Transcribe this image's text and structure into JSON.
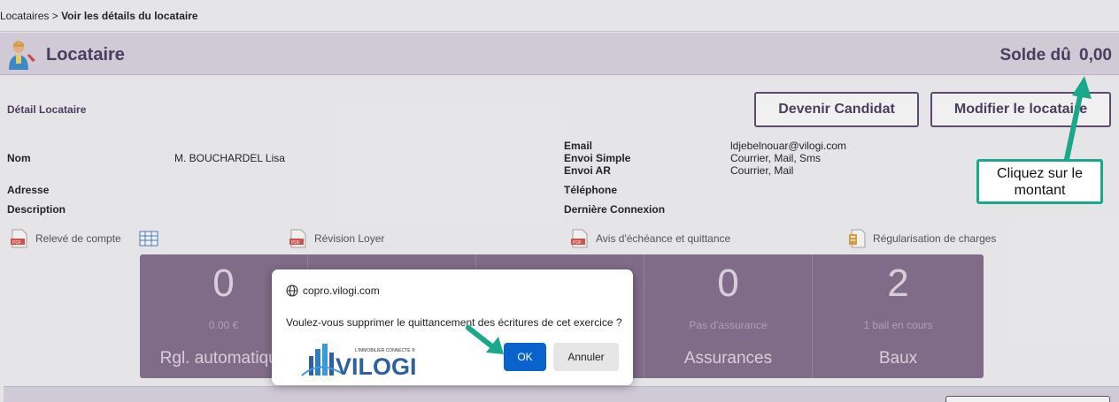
{
  "breadcrumb": {
    "parent": "Locataires",
    "separator": " > ",
    "current": "Voir les détails du locataire"
  },
  "header": {
    "title": "Locataire",
    "balance_label": "Solde dû",
    "balance_value": "0,00"
  },
  "detail": {
    "section_title": "Détail Locataire",
    "btn_candidat": "Devenir Candidat",
    "btn_modifier": "Modifier le locataire",
    "nom_label": "Nom",
    "nom_value": "M. BOUCHARDEL Lisa",
    "adresse_label": "Adresse",
    "description_label": "Description",
    "email_label": "Email",
    "email_value": "ldjebelnouar@vilogi.com",
    "envoi_simple_label": "Envoi Simple",
    "envoi_simple_value": "Courrier, Mail, Sms",
    "envoi_ar_label": "Envoi AR",
    "envoi_ar_value": "Courrier, Mail",
    "telephone_label": "Téléphone",
    "derniere_connexion_label": "Dernière Connexion"
  },
  "documents": {
    "releve": "Relevé de compte",
    "revision": "Révision Loyer",
    "avis": "Avis d'échéance et quittance",
    "regularisation": "Régularisation de charges"
  },
  "tiles": [
    {
      "num": "0",
      "sub": "0.00 €",
      "cap": "Rgl. automatique"
    },
    {
      "num": "",
      "sub": "",
      "cap": ""
    },
    {
      "num": "",
      "sub": "",
      "cap": ""
    },
    {
      "num": "0",
      "sub": "Pas d'assurance",
      "cap": "Assurances"
    },
    {
      "num": "2",
      "sub": "1 bail en cours",
      "cap": "Baux"
    }
  ],
  "dialog": {
    "origin": "copro.vilogi.com",
    "message": "Voulez-vous supprimer le quittancement des écritures de cet exercice ?",
    "logo_tagline": "L'IMMOBILIER CONNECTÉ ®",
    "logo_text": "VILOGI",
    "ok_label": "OK",
    "cancel_label": "Annuler"
  },
  "callout": {
    "text": "Cliquez sur le montant"
  },
  "colors": {
    "accent": "#4e3d61",
    "tile": "#86708f",
    "ok_button": "#0a62cc",
    "annotation": "#1aa88a"
  }
}
